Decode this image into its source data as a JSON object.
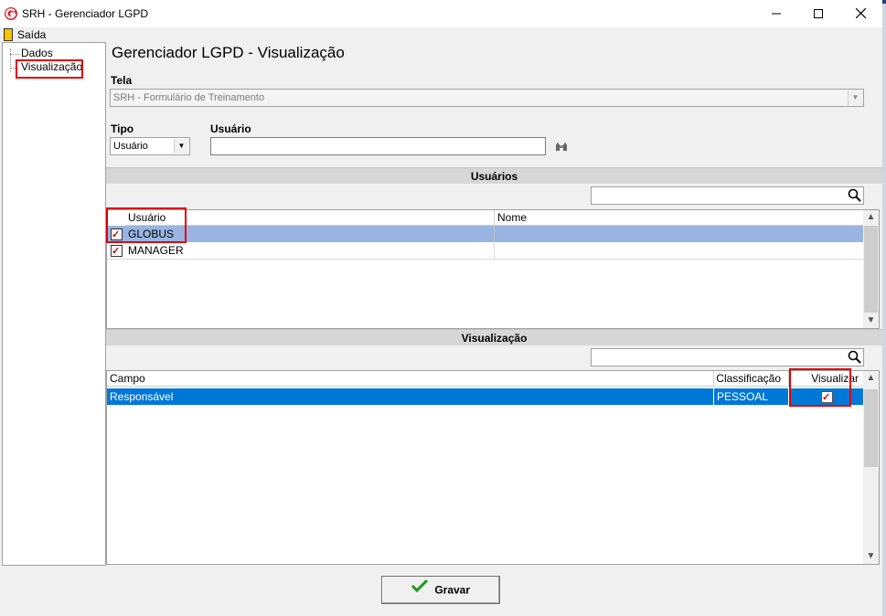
{
  "window": {
    "title": "SRH - Gerenciador LGPD",
    "controls": [
      "—",
      "☐",
      "✕"
    ]
  },
  "menu": {
    "exit_label": "Saída"
  },
  "tree": {
    "items": [
      "Dados",
      "Visualização"
    ]
  },
  "page_title": "Gerenciador LGPD - Visualização",
  "tela": {
    "label": "Tela",
    "value": "SRH - Formulário de Treinamento"
  },
  "tipo": {
    "label": "Tipo",
    "value": "Usuário"
  },
  "usuario": {
    "label": "Usuário",
    "value": ""
  },
  "usuarios_section": {
    "title": "Usuários",
    "search_value": "",
    "columns": [
      "Usuário",
      "Nome"
    ],
    "rows": [
      {
        "checked": true,
        "usuario": "GLOBUS",
        "nome": "",
        "selected": true
      },
      {
        "checked": true,
        "usuario": "MANAGER",
        "nome": "",
        "selected": false
      }
    ]
  },
  "visualizacao_section": {
    "title": "Visualização",
    "search_value": "",
    "columns": [
      "Campo",
      "Classificação",
      "Visualizar"
    ],
    "rows": [
      {
        "campo": "Responsável",
        "classificacao": "PESSOAL",
        "visualizar": true,
        "selected": true
      }
    ]
  },
  "save_button": {
    "label": "Gravar",
    "icon": "checkmark-icon"
  },
  "colors": {
    "row_selected": "#0078d7",
    "row_highlight": "#99b4e0",
    "annotation": "#e00000",
    "check": "#d00000"
  }
}
